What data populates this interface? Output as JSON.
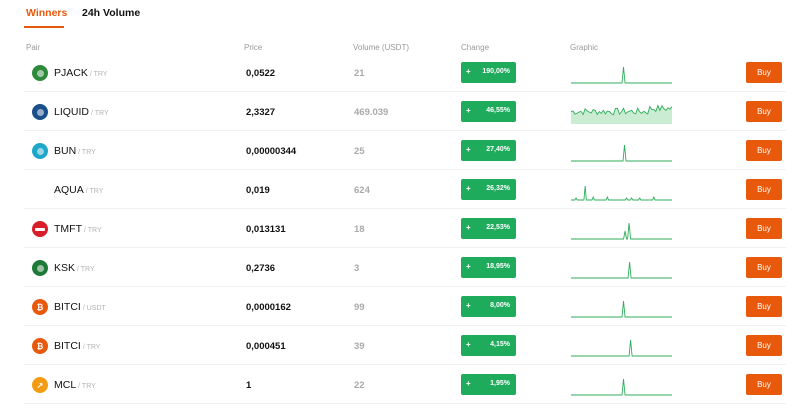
{
  "tabs": [
    {
      "label": "Winners",
      "active": true
    },
    {
      "label": "24h Volume",
      "active": false
    }
  ],
  "columns": {
    "pair": "Pair",
    "price": "Price",
    "volume": "Volume (USDT)",
    "change": "Change",
    "graphic": "Graphic"
  },
  "rows": [
    {
      "symbol": "PJACK",
      "quote": "/ TRY",
      "price": "0,0522",
      "volume": "21",
      "change": "190,00%",
      "icon": "pjack-coin-icon",
      "icon_color": "#2e8b3c",
      "spark": "spike",
      "spike_pos": 0.52
    },
    {
      "symbol": "LIQUID",
      "quote": "/ TRY",
      "price": "2,3327",
      "volume": "469.039",
      "change": "46,55%",
      "icon": "liquid-coin-icon",
      "icon_color": "#1a4f8a",
      "spark": "noisy",
      "spike_pos": 0.0
    },
    {
      "symbol": "BUN",
      "quote": "/ TRY",
      "price": "0,00000344",
      "volume": "25",
      "change": "27,40%",
      "icon": "bun-coin-icon",
      "icon_color": "#1ea7c9",
      "spark": "spike",
      "spike_pos": 0.53
    },
    {
      "symbol": "AQUA",
      "quote": "/ TRY",
      "price": "0,019",
      "volume": "624",
      "change": "26,32%",
      "icon": "",
      "icon_color": "#ffffff",
      "spark": "multi",
      "spike_pos": 0.14
    },
    {
      "symbol": "TMFT",
      "quote": "/ TRY",
      "price": "0,013131",
      "volume": "18",
      "change": "22,53%",
      "icon": "tmft-coin-icon",
      "icon_color": "#d81e2b",
      "spark": "double",
      "spike_pos": 0.57
    },
    {
      "symbol": "KSK",
      "quote": "/ TRY",
      "price": "0,2736",
      "volume": "3",
      "change": "18,95%",
      "icon": "ksk-coin-icon",
      "icon_color": "#1f7a3a",
      "spark": "spike",
      "spike_pos": 0.58
    },
    {
      "symbol": "BITCI",
      "quote": "/ USDT",
      "price": "0,0000162",
      "volume": "99",
      "change": "8,00%",
      "icon": "bitci-coin-icon",
      "icon_color": "#e8590c",
      "spark": "spike",
      "spike_pos": 0.52
    },
    {
      "symbol": "BITCI",
      "quote": "/ TRY",
      "price": "0,000451",
      "volume": "39",
      "change": "4,15%",
      "icon": "bitci-coin-icon",
      "icon_color": "#e8590c",
      "spark": "spike",
      "spike_pos": 0.59
    },
    {
      "symbol": "MCL",
      "quote": "/ TRY",
      "price": "1",
      "volume": "22",
      "change": "1,95%",
      "icon": "mcl-coin-icon",
      "icon_color": "#f39c12",
      "spark": "spike",
      "spike_pos": 0.52
    }
  ],
  "buy_label": "Buy",
  "change_prefix": "+",
  "colors": {
    "accent": "#e8590c",
    "positive": "#1fab5c",
    "spark_line": "#2fae5a",
    "spark_fill": "#c9ecd3"
  }
}
